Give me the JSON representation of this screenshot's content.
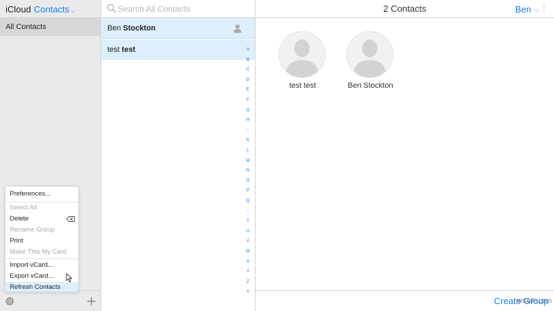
{
  "header": {
    "brand": "iCloud",
    "app_name": "Contacts",
    "app_menu_icon": "chevron-down-icon"
  },
  "sidebar": {
    "groups": [
      {
        "label": "All Contacts",
        "selected": true
      }
    ],
    "footer": {
      "settings_icon": "gear-icon",
      "add_icon": "plus-icon"
    }
  },
  "settings_menu": {
    "items": [
      {
        "label": "Preferences...",
        "enabled": true
      },
      {
        "label": "Select All",
        "enabled": false
      },
      {
        "label": "Delete",
        "enabled": true,
        "shortcut_icon": "delete-key-icon"
      },
      {
        "label": "Rename Group",
        "enabled": false
      },
      {
        "label": "Print",
        "enabled": true
      },
      {
        "label": "Make This My Card",
        "enabled": false
      },
      {
        "label": "Import vCard...",
        "enabled": true
      },
      {
        "label": "Export vCard...",
        "enabled": true
      },
      {
        "label": "Refresh Contacts",
        "enabled": true,
        "highlighted": true
      }
    ]
  },
  "search": {
    "placeholder": "Search All Contacts",
    "value": ""
  },
  "contacts_list": [
    {
      "first": "Ben",
      "last": "Stockton",
      "is_me": true
    },
    {
      "first": "test",
      "last": "test"
    }
  ],
  "alphabet_index": [
    "A",
    "B",
    "C",
    "D",
    "E",
    "F",
    "G",
    "H",
    "•",
    "K",
    "L",
    "M",
    "N",
    "O",
    "P",
    "Q",
    "•",
    "T",
    "U",
    "V",
    "W",
    "X",
    "Y",
    "Z",
    "#"
  ],
  "detail": {
    "title": "2 Contacts",
    "user_name": "Ben",
    "cards": [
      {
        "name": "test test"
      },
      {
        "name": "Ben Stockton"
      }
    ],
    "create_group_label": "Create Group"
  },
  "watermark": "wsxdn.com",
  "colors": {
    "accent": "#1a7cf0",
    "selection": "#dceffb",
    "sidebar_bg": "#eaeaeb"
  }
}
